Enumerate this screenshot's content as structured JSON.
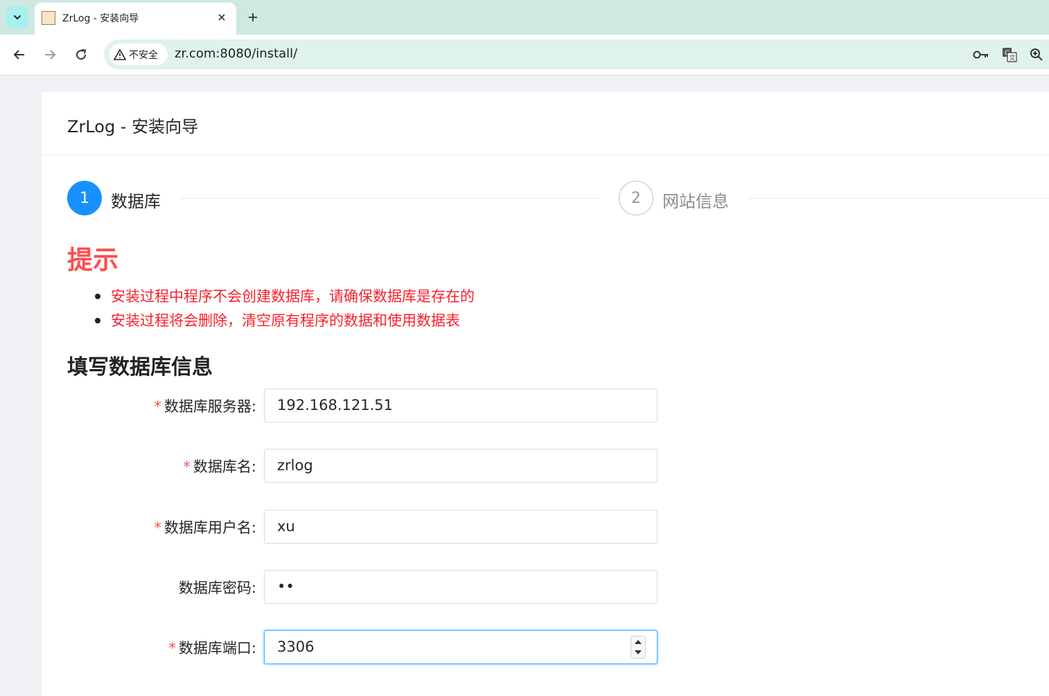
{
  "browser": {
    "tab_title": "ZrLog - 安装向导",
    "security_label": "不安全",
    "url": "zr.com:8080/install/"
  },
  "page": {
    "title": "ZrLog - 安装向导",
    "steps": [
      {
        "number": "1",
        "label": "数据库",
        "state": "active"
      },
      {
        "number": "2",
        "label": "网站信息",
        "state": "waiting"
      }
    ],
    "tip": {
      "heading": "提示",
      "items": [
        "安装过程中程序不会创建数据库，请确保数据库是存在的",
        "安装过程将会删除，清空原有程序的数据和使用数据表"
      ]
    },
    "form": {
      "heading": "填写数据库信息",
      "fields": [
        {
          "label": "数据库服务器:",
          "required": true,
          "value": "192.168.121.51"
        },
        {
          "label": "数据库名:",
          "required": true,
          "value": "zrlog"
        },
        {
          "label": "数据库用户名:",
          "required": true,
          "value": "xu"
        },
        {
          "label": "数据库密码:",
          "required": false,
          "value": "••"
        },
        {
          "label": "数据库端口:",
          "required": true,
          "value": "3306"
        }
      ],
      "required_mark": "*"
    }
  },
  "colors": {
    "accent": "#1890ff",
    "danger": "#ff4d4f",
    "tabbar": "#cde9e2"
  }
}
